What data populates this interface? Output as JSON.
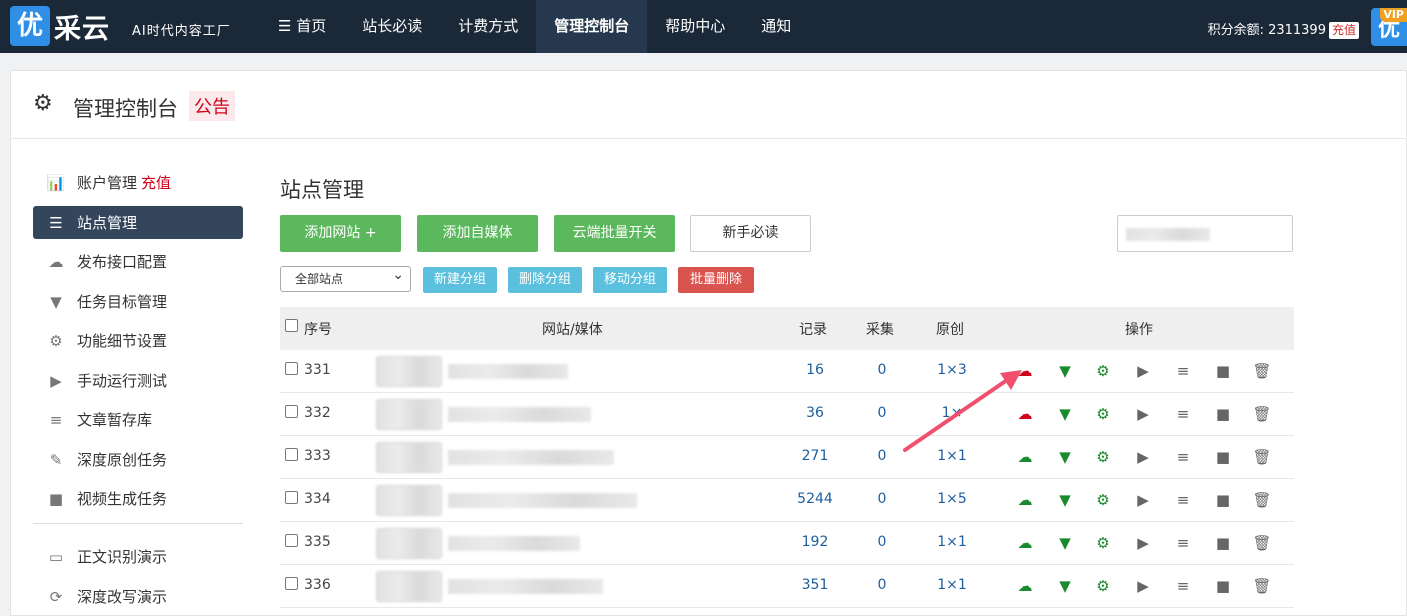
{
  "header": {
    "logo_mark": "优",
    "logo_text": "采云",
    "logo_sub": "AI时代内容工厂",
    "nav": [
      "☰ 首页",
      "站长必读",
      "计费方式",
      "管理控制台",
      "帮助中心",
      "通知"
    ],
    "active_nav": 3,
    "credit_label": "积分余额: 2311399",
    "credit_button": "充值",
    "vip_mark": "优",
    "vip_label": "VIP"
  },
  "page": {
    "title": "管理控制台",
    "notice": "公告"
  },
  "sidebar": {
    "items": [
      {
        "label": "账户管理",
        "extra": "充值",
        "icon": "bar-chart-icon"
      },
      {
        "label": "站点管理",
        "icon": "server-icon",
        "active": true
      },
      {
        "label": "发布接口配置",
        "icon": "cloud-upload-icon"
      },
      {
        "label": "任务目标管理",
        "icon": "filter-icon"
      },
      {
        "label": "功能细节设置",
        "icon": "cogs-icon"
      },
      {
        "label": "手动运行测试",
        "icon": "play-circle-icon"
      },
      {
        "label": "文章暂存库",
        "icon": "database-icon"
      },
      {
        "label": "深度原创任务",
        "icon": "edit-icon"
      },
      {
        "label": "视频生成任务",
        "icon": "video-camera-icon"
      }
    ],
    "items2": [
      {
        "label": "正文识别演示",
        "icon": "monitor-icon"
      },
      {
        "label": "深度改写演示",
        "icon": "refresh-icon"
      }
    ]
  },
  "content": {
    "title": "站点管理",
    "buttons": {
      "add_site": "添加网站 +",
      "add_media": "添加自媒体",
      "cloud_batch": "云端批量开关",
      "newbie": "新手必读"
    },
    "group_select": "全部站点",
    "small_buttons": {
      "new_group": "新建分组",
      "delete_group": "删除分组",
      "move_group": "移动分组",
      "batch_delete": "批量删除"
    },
    "colors": {
      "green": "#5cb85c",
      "blue": "#5bc0de",
      "red": "#d9534f",
      "sidebar_active": "#34465c",
      "arrow": "#f0506e"
    }
  },
  "table": {
    "headers": {
      "index": "序号",
      "site": "网站/媒体",
      "records": "记录",
      "collect": "采集",
      "original": "原创",
      "actions": "操作"
    },
    "rows": [
      {
        "id": "331",
        "records": "16",
        "collect": "0",
        "original": "1×3",
        "upload_color": "red"
      },
      {
        "id": "332",
        "records": "36",
        "collect": "0",
        "original": "1×",
        "upload_color": "red"
      },
      {
        "id": "333",
        "records": "271",
        "collect": "0",
        "original": "1×1",
        "upload_color": "green"
      },
      {
        "id": "334",
        "records": "5244",
        "collect": "0",
        "original": "1×5",
        "upload_color": "green"
      },
      {
        "id": "335",
        "records": "192",
        "collect": "0",
        "original": "1×1",
        "upload_color": "green"
      },
      {
        "id": "336",
        "records": "351",
        "collect": "0",
        "original": "1×1",
        "upload_color": "green"
      }
    ],
    "action_icons": [
      "cloud-upload-icon",
      "filter-icon",
      "cogs-icon",
      "play-circle-icon",
      "database-icon",
      "video-camera-icon",
      "trash-icon"
    ]
  }
}
